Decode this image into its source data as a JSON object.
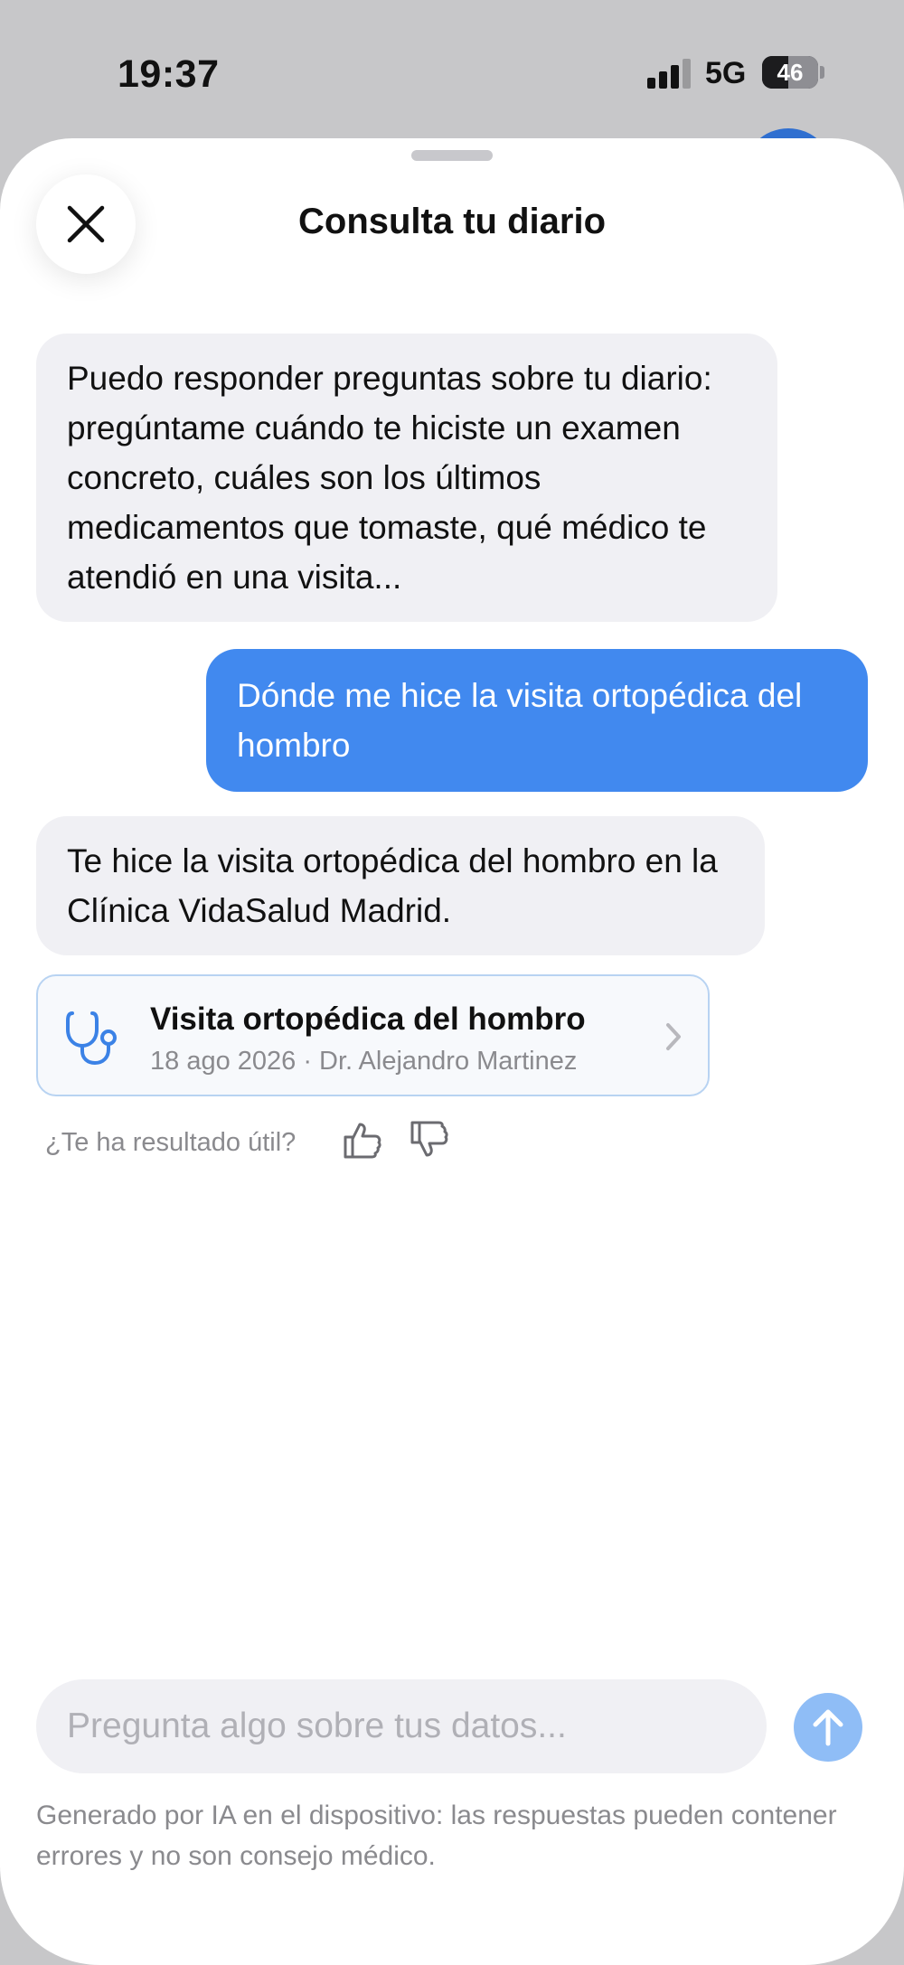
{
  "status_bar": {
    "time": "19:37",
    "network": "5G",
    "battery": "46"
  },
  "sheet": {
    "title": "Consulta tu diario"
  },
  "messages": [
    {
      "role": "assistant",
      "text": "Puedo responder preguntas sobre tu diario: pregúntame cuándo te hiciste un examen concreto, cuáles son los últimos medicamentos que tomaste, qué médico te atendió en una visita..."
    },
    {
      "role": "user",
      "text": "Dónde me hice la visita ortopédica del hombro"
    },
    {
      "role": "assistant",
      "text": "Te hice la visita ortopédica del hombro en la Clínica VidaSalud Madrid."
    }
  ],
  "record_card": {
    "icon": "stethoscope-icon",
    "title": "Visita ortopédica del hombro",
    "subtitle": "18 ago 2026 · Dr. Alejandro Martinez"
  },
  "feedback": {
    "label": "¿Te ha resultado útil?"
  },
  "composer": {
    "placeholder": "Pregunta algo sobre tus datos...",
    "value": ""
  },
  "disclaimer": "Generado por IA en el dispositivo: las respuestas pueden contener errores y no son consejo médico.",
  "colors": {
    "accent": "#4189ef",
    "send_button": "#8fbdf6",
    "bubble_ai": "#f0f0f4",
    "card_border": "#b8d3f2",
    "secondary_text": "#8a8a8e"
  }
}
